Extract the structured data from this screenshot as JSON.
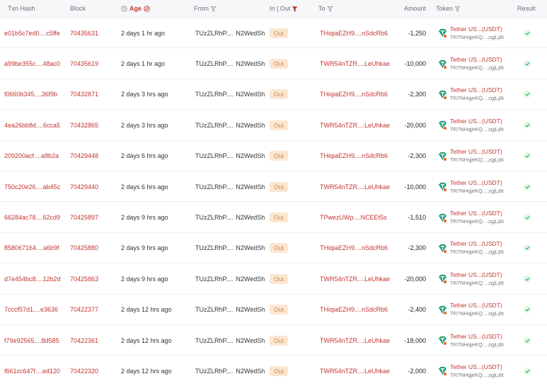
{
  "columns": {
    "hash": "Txn Hash",
    "block": "Block",
    "age": "Age",
    "from": "From",
    "inout": "In | Out",
    "to": "To",
    "amount": "Amount",
    "token": "Token",
    "result": "Result"
  },
  "colors": {
    "accent": "#c23631",
    "out_badge_bg": "#fbe6d2",
    "out_badge_text": "#d7853b",
    "tether": "#26a17b",
    "success": "#35b34a"
  },
  "rows": [
    {
      "hash": "e01b5c7ed0....c5ffe",
      "block": "70435631",
      "age": "2 days 1 hr ago",
      "from_a": "TUzZLRhP....",
      "from_b": "N2WedSh",
      "dir": "Out",
      "to": "THiqiaEZH9....nSdcRb6",
      "amount": "-1,250",
      "token_name": "Tether US...(USDT)",
      "token_addr": "TR7NHqjeKQ....zgjLj6t"
    },
    {
      "hash": "a99be355c....48ac0",
      "block": "70435619",
      "age": "2 days 1 hr ago",
      "from_a": "TUzZLRhP....",
      "from_b": "N2WedSh",
      "dir": "Out",
      "to": "TWR54nTZR....LeUhkae",
      "amount": "-10,000",
      "token_name": "Tether US...(USDT)",
      "token_addr": "TR7NHqjeKQ....zgjLj6t"
    },
    {
      "hash": "f0660b345....36f9b",
      "block": "70432871",
      "age": "2 days 3 hrs ago",
      "from_a": "TUzZLRhP....",
      "from_b": "N2WedSh",
      "dir": "Out",
      "to": "THiqiaEZH9....nSdcRb6",
      "amount": "-2,300",
      "token_name": "Tether US...(USDT)",
      "token_addr": "TR7NHqjeKQ....zgjLj6t"
    },
    {
      "hash": "4ea26bb8d....6cca5",
      "block": "70432865",
      "age": "2 days 3 hrs ago",
      "from_a": "TUzZLRhP....",
      "from_b": "N2WedSh",
      "dir": "Out",
      "to": "TWR54nTZR....LeUhkae",
      "amount": "-20,000",
      "token_name": "Tether US...(USDT)",
      "token_addr": "TR7NHqjeKQ....zgjLj6t"
    },
    {
      "hash": "209200acf....a8b2a",
      "block": "70429448",
      "age": "2 days 6 hrs ago",
      "from_a": "TUzZLRhP....",
      "from_b": "N2WedSh",
      "dir": "Out",
      "to": "THiqiaEZH9....nSdcRb6",
      "amount": "-2,300",
      "token_name": "Tether US...(USDT)",
      "token_addr": "TR7NHqjeKQ....zgjLj6t"
    },
    {
      "hash": "750c20e26....ab45c",
      "block": "70429440",
      "age": "2 days 6 hrs ago",
      "from_a": "TUzZLRhP....",
      "from_b": "N2WedSh",
      "dir": "Out",
      "to": "TWR54nTZR....LeUhkae",
      "amount": "-10,000",
      "token_name": "Tether US...(USDT)",
      "token_addr": "TR7NHqjeKQ....zgjLj6t"
    },
    {
      "hash": "66284ac78....62cd9",
      "block": "70425897",
      "age": "2 days 9 hrs ago",
      "from_a": "TUzZLRhP....",
      "from_b": "N2WedSh",
      "dir": "Out",
      "to": "TPwezUWp....NCEEt5s",
      "amount": "-1,510",
      "token_name": "Tether US...(USDT)",
      "token_addr": "TR7NHqjeKQ....zgjLj6t"
    },
    {
      "hash": "858067164....a6b9f",
      "block": "70425880",
      "age": "2 days 9 hrs ago",
      "from_a": "TUzZLRhP....",
      "from_b": "N2WedSh",
      "dir": "Out",
      "to": "THiqiaEZH9....nSdcRb6",
      "amount": "-2,300",
      "token_name": "Tether US...(USDT)",
      "token_addr": "TR7NHqjeKQ....zgjLj6t"
    },
    {
      "hash": "d7e454bc8....12b2d",
      "block": "70425863",
      "age": "2 days 9 hrs ago",
      "from_a": "TUzZLRhP....",
      "from_b": "N2WedSh",
      "dir": "Out",
      "to": "TWR54nTZR....LeUhkae",
      "amount": "-20,000",
      "token_name": "Tether US...(USDT)",
      "token_addr": "TR7NHqjeKQ....zgjLj6t"
    },
    {
      "hash": "7cccf57d1....e3636",
      "block": "70422377",
      "age": "2 days 12 hrs ago",
      "from_a": "TUzZLRhP....",
      "from_b": "N2WedSh",
      "dir": "Out",
      "to": "THiqiaEZH9....nSdcRb6",
      "amount": "-2,400",
      "token_name": "Tether US...(USDT)",
      "token_addr": "TR7NHqjeKQ....zgjLj6t"
    },
    {
      "hash": "f79e92565....8d585",
      "block": "70422361",
      "age": "2 days 12 hrs ago",
      "from_a": "TUzZLRhP....",
      "from_b": "N2WedSh",
      "dir": "Out",
      "to": "TWR54nTZR....LeUhkae",
      "amount": "-18,000",
      "token_name": "Tether US...(USDT)",
      "token_addr": "TR7NHqjeKQ....zgjLj6t"
    },
    {
      "hash": "f661cc647f....ed120",
      "block": "70422320",
      "age": "2 days 12 hrs ago",
      "from_a": "TUzZLRhP....",
      "from_b": "N2WedSh",
      "dir": "Out",
      "to": "TWR54nTZR....LeUhkae",
      "amount": "-2,000",
      "token_name": "Tether US...(USDT)",
      "token_addr": "TR7NHqjeKQ....zgjLj6t"
    }
  ]
}
